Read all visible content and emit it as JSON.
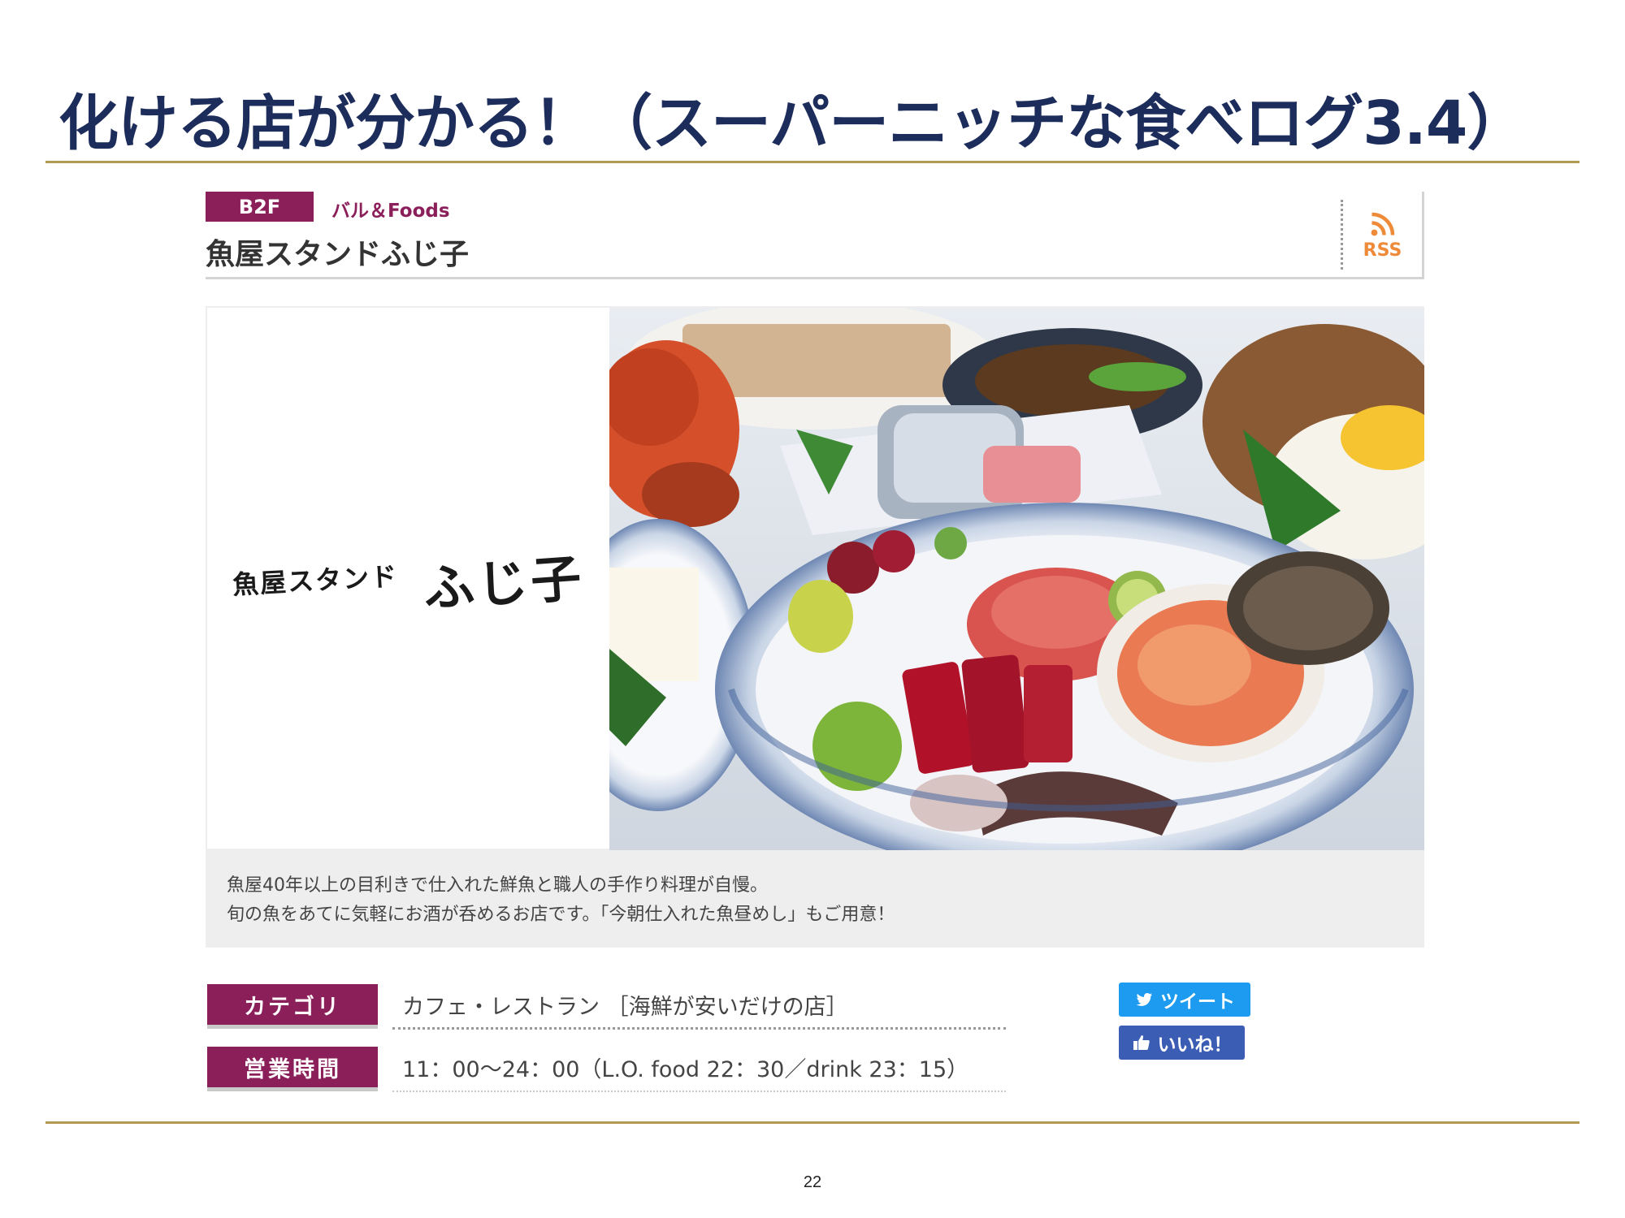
{
  "slide": {
    "title": "化ける店が分かる！（スーパーニッチな食べログ3.4）",
    "page_number": "22"
  },
  "store": {
    "floor": "B2F",
    "category_tag": "バル＆Foods",
    "name": "魚屋スタンドふじ子",
    "rss_label": "RSS",
    "logo_sub": "魚屋スタンド",
    "logo_main": "ふじ子",
    "description_lines": [
      "魚屋40年以上の目利きで仕入れた鮮魚と職人の手作り料理が自慢。",
      "旬の魚をあてに気軽にお酒が呑めるお店です。「今朝仕入れた魚昼めし」もご用意！"
    ]
  },
  "info": {
    "category_label": "カテゴリ",
    "category_value": "カフェ・レストラン ［海鮮が安いだけの店］",
    "hours_label": "営業時間",
    "hours_value": "11：00〜24：00（L.O. food 22：30／drink 23：15）"
  },
  "social": {
    "tweet_label": "ツイート",
    "like_label": "いいね！"
  },
  "colors": {
    "title": "#1c2c5b",
    "rule": "#b29a52",
    "accent": "#8b1f5a",
    "rss": "#ee8a38",
    "twitter": "#1d9bf0",
    "facebook": "#3b5db4"
  },
  "icons": [
    "rss-icon",
    "twitter-bird-icon",
    "thumbs-up-icon"
  ]
}
